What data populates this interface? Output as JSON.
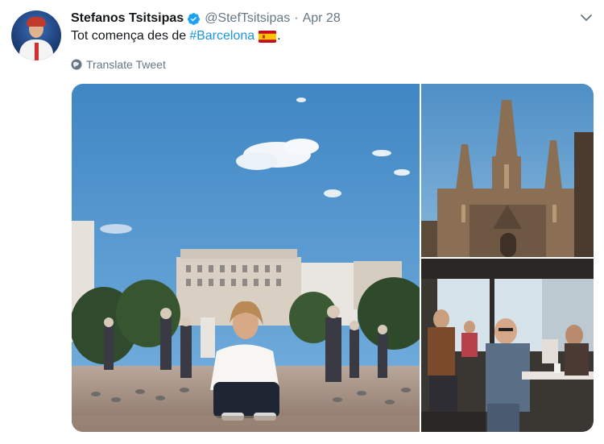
{
  "author": {
    "name": "Stefanos Tsitsipas",
    "handle": "@StefTsitsipas",
    "separator": "·",
    "date": "Apr 28",
    "verified": true
  },
  "tweet": {
    "text": "Tot comença des de",
    "hashtag": "#Barcelona",
    "trailing": ".",
    "flag": "spain-flag"
  },
  "translate_label": "Translate Tweet",
  "media": {
    "photos": [
      "plaza-portrait-photo",
      "cathedral-photo",
      "cafe-photo"
    ]
  },
  "colors": {
    "link": "#1b95e0",
    "secondary_text": "#657786",
    "sky": "#4a90c8"
  }
}
